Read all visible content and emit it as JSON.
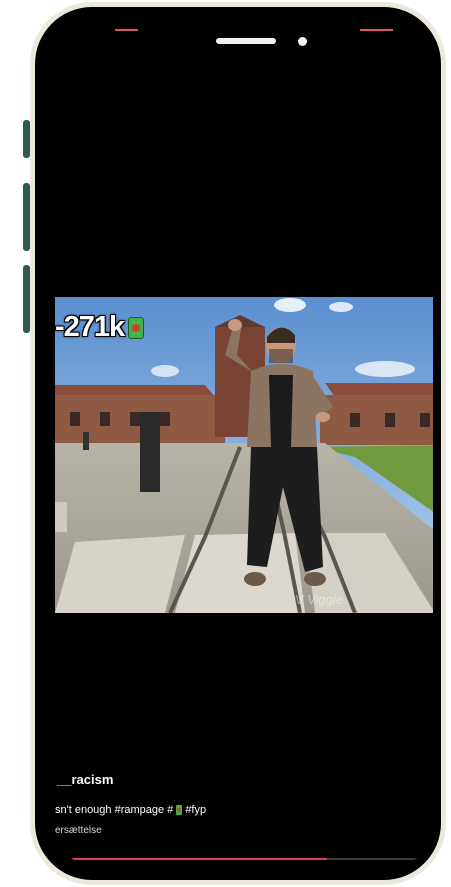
{
  "video": {
    "overlay_count": "-271k",
    "watermark": "V Viggle"
  },
  "post": {
    "username": "__racism",
    "description_prefix": "sn't enough #rampage #",
    "description_suffix": "#fyp",
    "translate_label": "ersættelse"
  },
  "playback": {
    "progress_fraction": 0.72
  },
  "colors": {
    "phone_frame": "#ece8dc",
    "side_buttons": "#2f5a50",
    "progress_accent": "#e2385a"
  },
  "icons": {
    "overlay_emoji": "soda-can-icon",
    "caption_emoji": "soda-can-icon"
  }
}
